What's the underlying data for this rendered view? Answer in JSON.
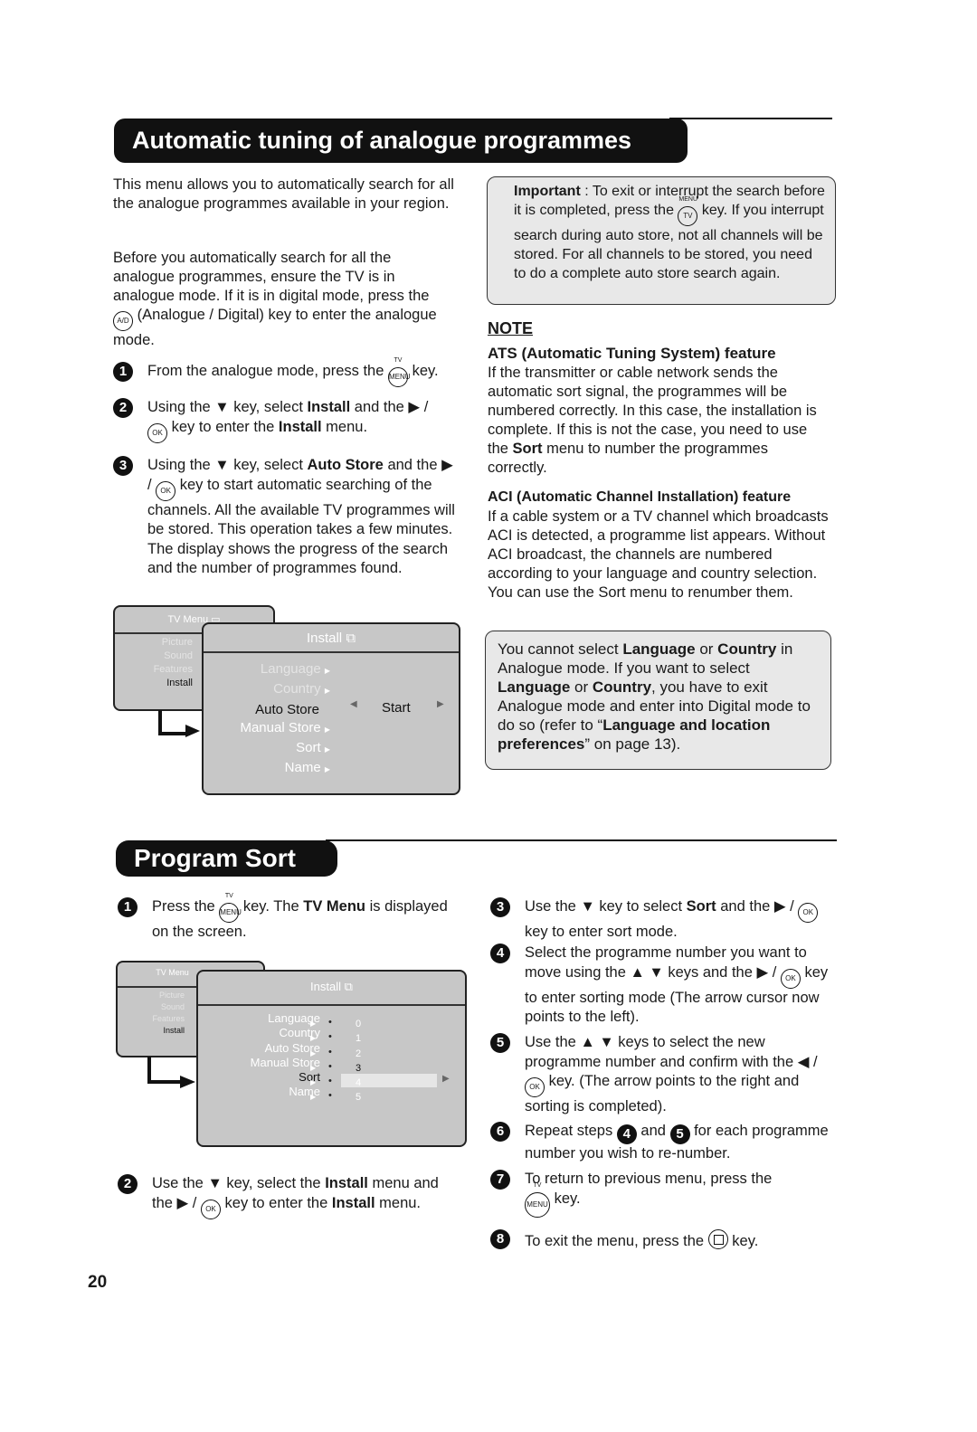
{
  "section1": {
    "title": "Automatic tuning of analogue programmes",
    "intro1": [
      "This menu allows you to automatically search for all the analogue programmes available in your region."
    ],
    "intro2": [
      "Before you automatically search for all the analogue programmes, ensure the TV is in analogue mode. If it is in digital mode, press the ",
      {
        "key": "A/D"
      },
      " (Analogue / Digital) key to enter the analogue mode."
    ],
    "steps": [
      {
        "n": "1",
        "text": [
          "From the analogue mode, press the ",
          {
            "key": "MENU",
            "sup": "TV"
          },
          " key."
        ]
      },
      {
        "n": "2",
        "text": [
          "Using the ▼ key, select ",
          {
            "b": "Install"
          },
          " and the ▶ / ",
          {
            "key": "OK"
          },
          " key to enter the ",
          {
            "b": "Install"
          },
          " menu."
        ]
      },
      {
        "n": "3",
        "text": [
          "Using the ▼ key, select ",
          {
            "b": "Auto Store"
          },
          " and the ▶ / ",
          {
            "key": "OK"
          },
          " key to start automatic searching of the channels. All the available TV programmes will be stored. This operation takes a few minutes. The display shows the progress of the search and the number of programmes found."
        ]
      }
    ],
    "important": [
      {
        "b": "Important"
      },
      " : To exit or interrupt the search before it is completed, press the ",
      {
        "key": "TV",
        "sup": "MENU"
      },
      " key. If you interrupt search during auto store, not all channels will be stored. For all channels to be stored, you need to do a complete auto store search again."
    ],
    "note_heading": "NOTE",
    "ats_heading": "ATS (Automatic Tuning System) feature",
    "ats_text": [
      "If the transmitter or cable network sends the automatic sort signal, the programmes will be numbered correctly. In this case, the installation is complete. If this is not the case, you need to use the ",
      {
        "b": "Sort"
      },
      " menu to number the programmes correctly."
    ],
    "aci_heading": "ACI (Automatic Channel Installation) feature",
    "aci_text": [
      "If a cable system or a TV channel which broadcasts ACI is detected, a programme list appears. Without ACI broadcast, the channels are numbered according to your language and country selection. You can use the Sort menu to renumber them."
    ],
    "language_note": [
      "You cannot select ",
      {
        "b": "Language"
      },
      " or ",
      {
        "b": "Country"
      },
      " in Analogue mode. If you want to select ",
      {
        "b": "Language"
      },
      " or ",
      {
        "b": "Country"
      },
      ", you have to exit Analogue mode and enter into Digital mode to do so (refer to “",
      {
        "b": "Language and location preferences"
      },
      "” on page 13)."
    ],
    "menu": {
      "tv_title": "TV Menu",
      "tv_items": [
        "Picture",
        "Sound",
        "Features",
        "Install"
      ],
      "install_title": "Install",
      "items": [
        "Language",
        "Country",
        "Auto Store",
        "Manual Store",
        "Sort",
        "Name"
      ],
      "value": "Start"
    }
  },
  "section2": {
    "title": "Program Sort",
    "steps_left": [
      {
        "n": "1",
        "text": [
          "Press the ",
          {
            "key": "MENU",
            "sup": "TV"
          },
          " key. The ",
          {
            "b": "TV Menu"
          },
          " is displayed on the screen."
        ]
      },
      {
        "n": "2",
        "text": [
          "Use the ▼ key, select the ",
          {
            "b": "Install"
          },
          " menu and the ▶ / ",
          {
            "key": "OK"
          },
          " key to enter the ",
          {
            "b": "Install"
          },
          " menu."
        ]
      }
    ],
    "steps_right": [
      {
        "n": "3",
        "text": [
          "Use the ▼ key to select ",
          {
            "b": "Sort"
          },
          " and the ▶ / ",
          {
            "key": "OK"
          },
          " key to enter sort mode."
        ]
      },
      {
        "n": "4",
        "text": [
          "Select the programme number you want to move using the ▲ ▼ keys and the ▶ / ",
          {
            "key": "OK"
          },
          " key to enter sorting mode (The arrow cursor now points to the left)."
        ]
      },
      {
        "n": "5",
        "text": [
          "Use the ▲ ▼  keys to select the new programme number and confirm with the ◀ / ",
          {
            "key": "OK"
          },
          " key. (The arrow points to the right and sorting is completed)."
        ]
      },
      {
        "n": "6",
        "text": [
          "Repeat steps ",
          {
            "num": "4"
          },
          " and ",
          {
            "num": "5"
          },
          "  for each programme number you wish to re-number."
        ]
      },
      {
        "n": "7",
        "text": [
          "To return to previous menu, press the ",
          {
            "br": 1
          },
          {
            "key": "MENU",
            "sup": "TV",
            "big": 1
          },
          " key."
        ]
      },
      {
        "n": "8",
        "text": [
          "To exit the menu, press the ",
          {
            "sq": "exit"
          },
          " key."
        ]
      }
    ],
    "menu": {
      "tv_title": "TV Menu",
      "tv_items": [
        "Picture",
        "Sound",
        "Features",
        "Install"
      ],
      "install_title": "Install",
      "items": [
        "Language",
        "Country",
        "Auto Store",
        "Manual Store",
        "Sort",
        "Name"
      ],
      "numbers": [
        "0",
        "1",
        "2",
        "3",
        "4",
        "5"
      ],
      "selected": "4"
    }
  },
  "page_number": "20"
}
